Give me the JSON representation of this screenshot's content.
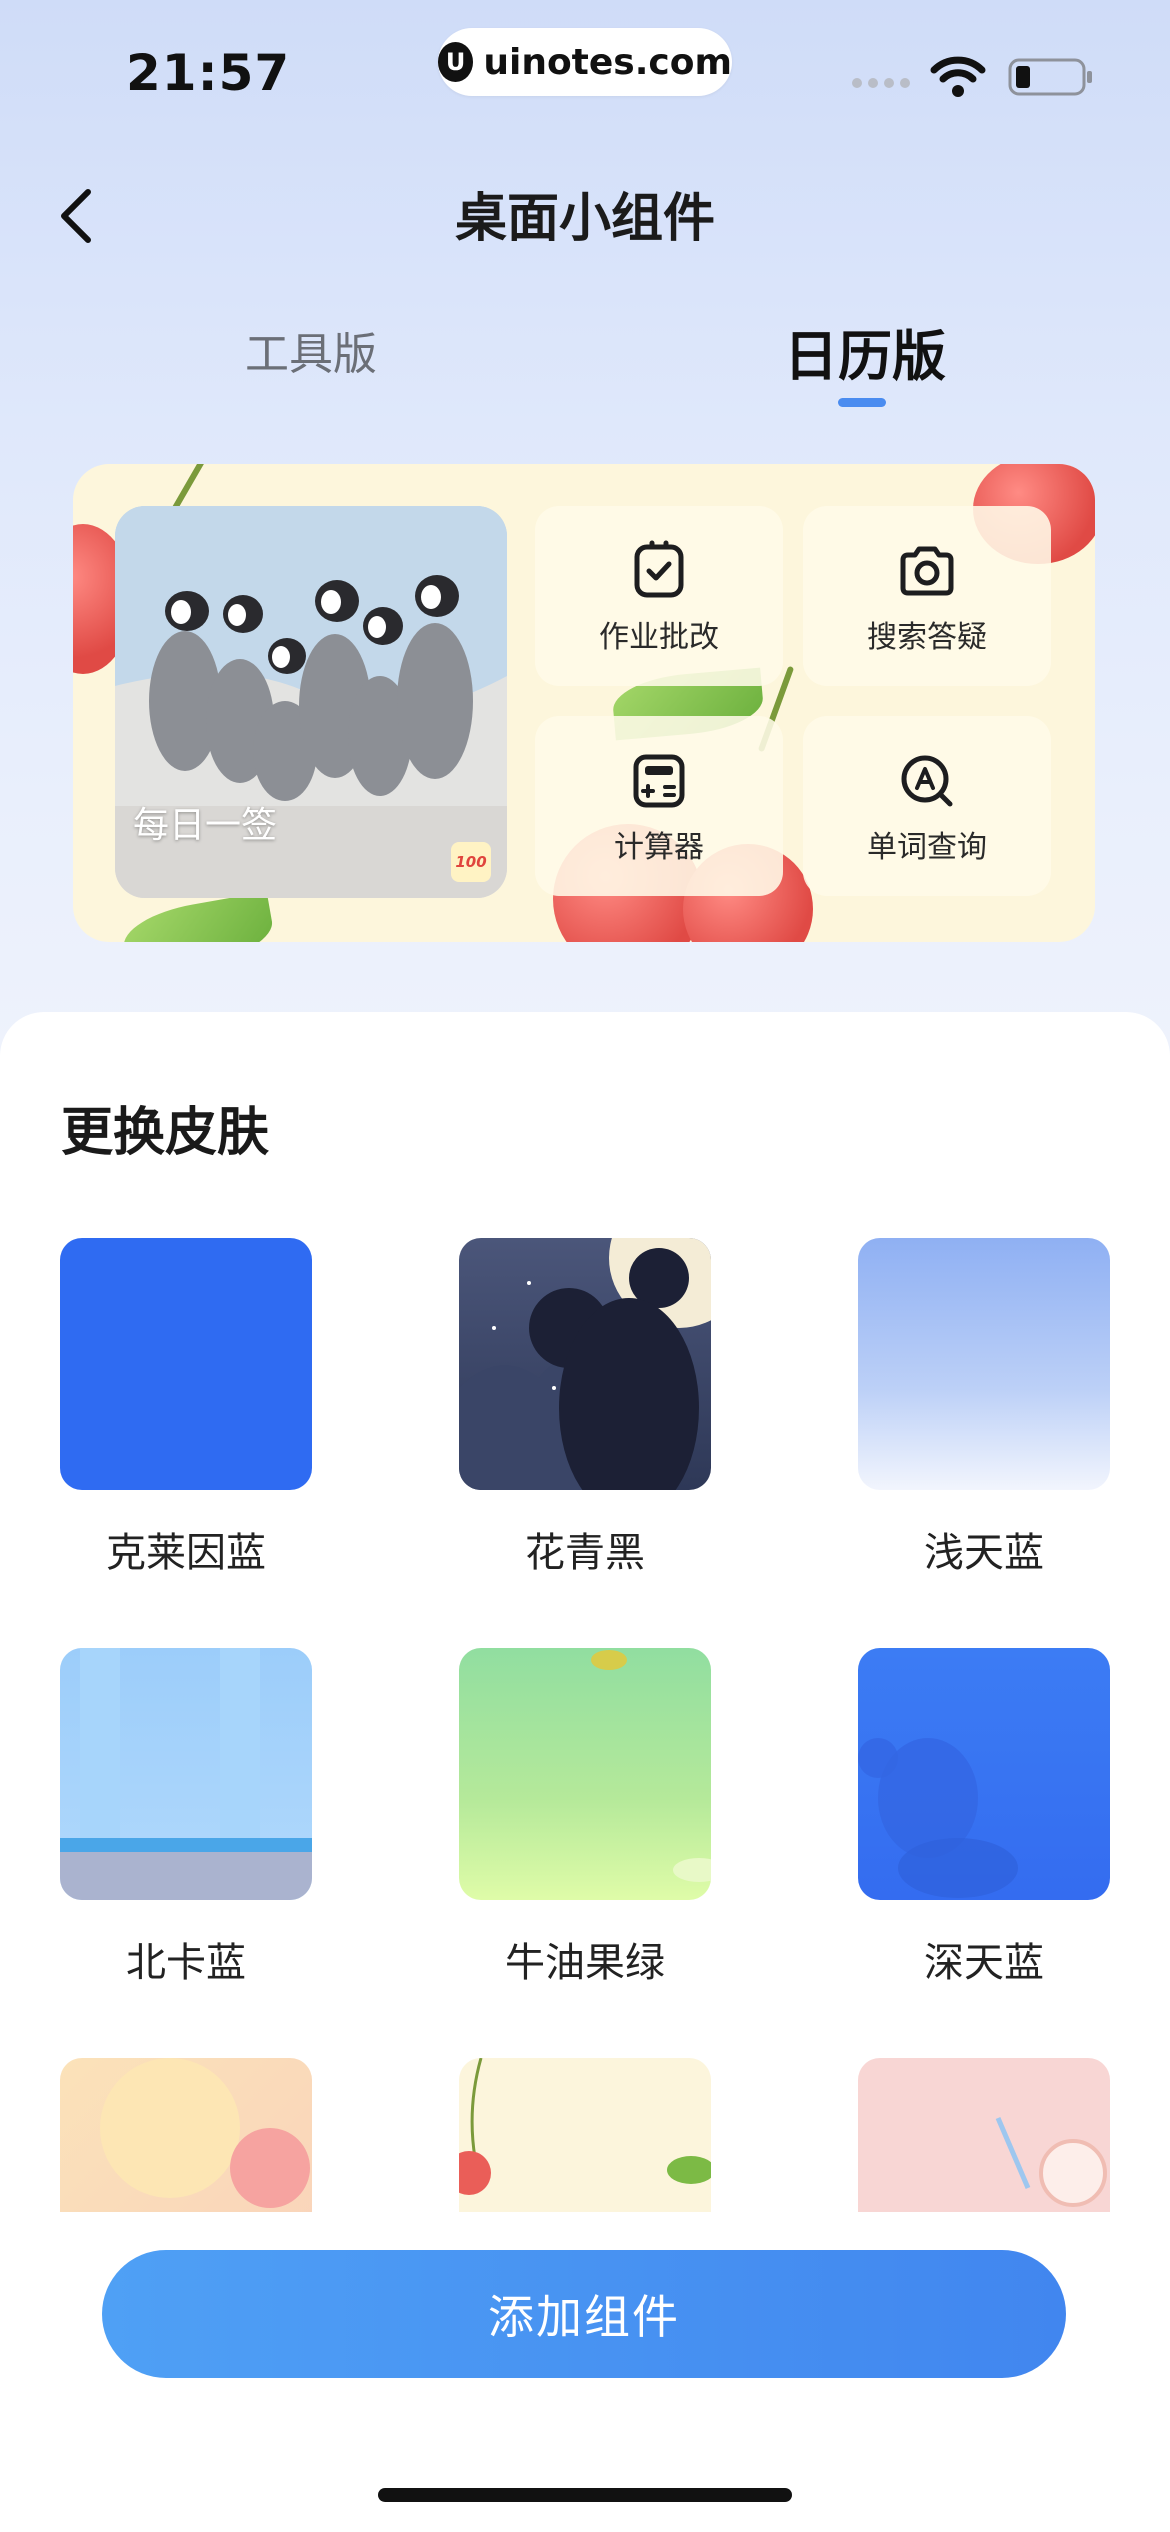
{
  "status_bar": {
    "time": "21:57",
    "url": "uinotes.com",
    "url_logo": "U"
  },
  "header": {
    "title": "桌面小组件",
    "back_icon": "chevron-left-icon"
  },
  "tabs": [
    {
      "label": "工具版",
      "active": false
    },
    {
      "label": "日历版",
      "active": true
    }
  ],
  "widget": {
    "photo_caption": "每日一签",
    "badge": "100",
    "tools": [
      {
        "label": "作业批改",
        "icon": "homework-check-icon"
      },
      {
        "label": "搜索答疑",
        "icon": "camera-icon"
      },
      {
        "label": "计算器",
        "icon": "calculator-icon"
      },
      {
        "label": "单词查询",
        "icon": "word-lookup-icon"
      }
    ]
  },
  "skins": {
    "title": "更换皮肤",
    "items": [
      {
        "label": "克莱因蓝",
        "color": "#2f6bf2"
      },
      {
        "label": "花青黑",
        "color": "#3b4668"
      },
      {
        "label": "浅天蓝",
        "color": "#a4bff5"
      },
      {
        "label": "北卡蓝",
        "color": "#a9d4fb"
      },
      {
        "label": "牛油果绿",
        "color": "#a6e39c"
      },
      {
        "label": "深天蓝",
        "color": "#3d7af2"
      }
    ]
  },
  "add_button": {
    "label": "添加组件"
  }
}
